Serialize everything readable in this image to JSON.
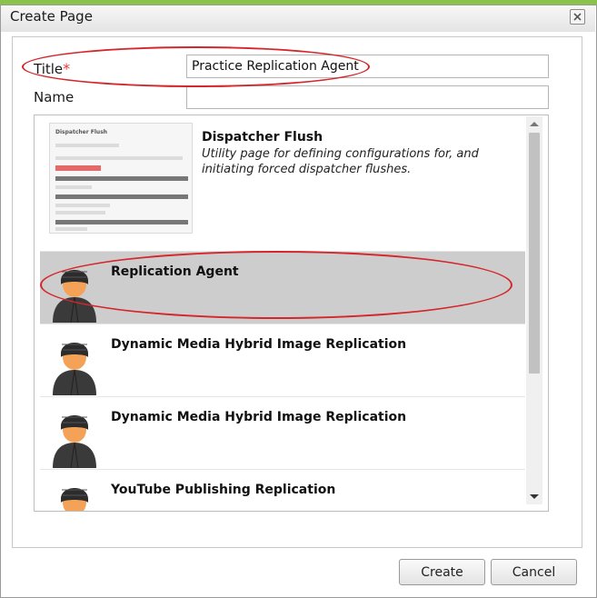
{
  "dialog": {
    "title": "Create Page",
    "close_label": "×"
  },
  "form": {
    "title_label": "Title",
    "title_required": "*",
    "title_value": "Practice Replication Agent",
    "name_label": "Name",
    "name_value": ""
  },
  "templates": [
    {
      "title": "Dispatcher Flush",
      "description": "Utility page for defining configurations for, and initiating forced dispatcher flushes.",
      "thumbnail_title": "Dispatcher Flush",
      "selected": false
    },
    {
      "title": "Replication Agent",
      "description": "",
      "selected": true
    },
    {
      "title": "Dynamic Media Hybrid Image Replication",
      "description": "",
      "selected": false
    },
    {
      "title": "Dynamic Media Hybrid Image Replication",
      "description": "",
      "selected": false
    },
    {
      "title": "YouTube Publishing Replication",
      "description": "",
      "selected": false
    }
  ],
  "buttons": {
    "create": "Create",
    "cancel": "Cancel"
  },
  "colors": {
    "accent_bar": "#8bc34a",
    "annotation": "#d4262b",
    "selected_row": "#cdcdcd"
  },
  "icons": {
    "agent_avatar": "hooded-person-icon",
    "close": "close-icon"
  }
}
